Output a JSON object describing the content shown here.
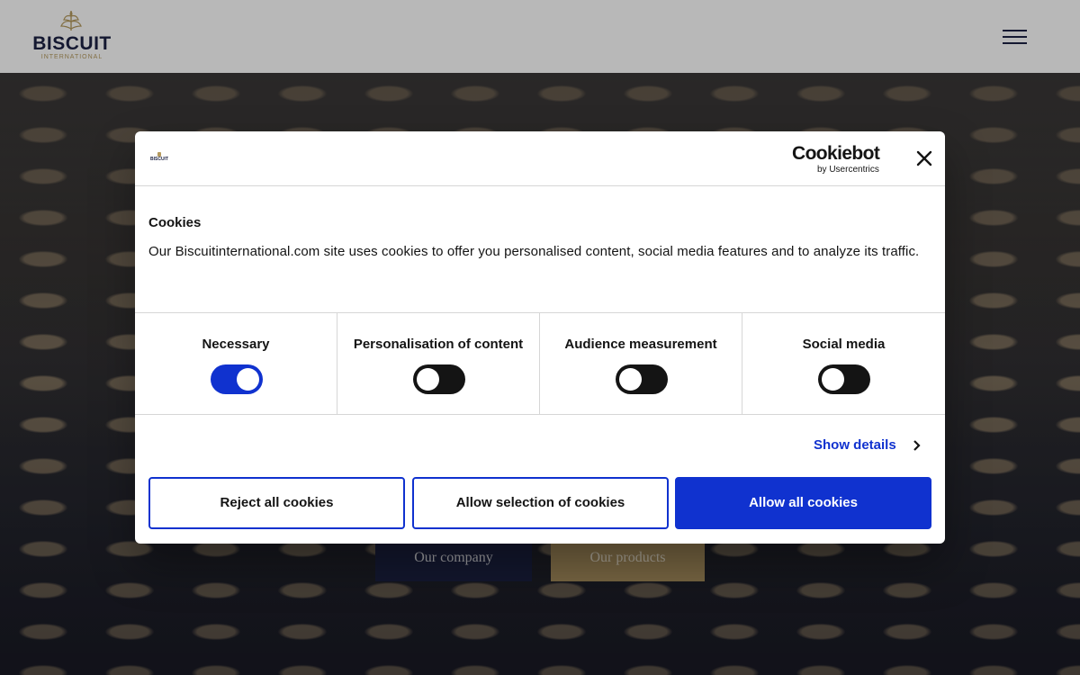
{
  "header": {
    "logo_text": "BISCUIT",
    "logo_subtext": "INTERNATIONAL",
    "menu_icon": "hamburger-menu-icon"
  },
  "hero": {
    "company_button": "Our company",
    "products_button": "Our products"
  },
  "cookie_dialog": {
    "logo_text": "BISCUIT",
    "brand_main": "Cookiebot",
    "brand_sub": "by Usercentrics",
    "title": "Cookies",
    "description": "Our Biscuitinternational.com site uses cookies to offer you personalised content, social media features and to analyze its traffic.",
    "categories": [
      {
        "label": "Necessary",
        "enabled": true
      },
      {
        "label": "Personalisation of content",
        "enabled": false
      },
      {
        "label": "Audience measurement",
        "enabled": false
      },
      {
        "label": "Social media",
        "enabled": false
      }
    ],
    "show_details": "Show details",
    "reject_button": "Reject all cookies",
    "selection_button": "Allow selection of cookies",
    "allow_button": "Allow all cookies"
  },
  "colors": {
    "brand_navy": "#1c2244",
    "brand_gold": "#b59a5e",
    "accent_blue": "#1032cf"
  }
}
